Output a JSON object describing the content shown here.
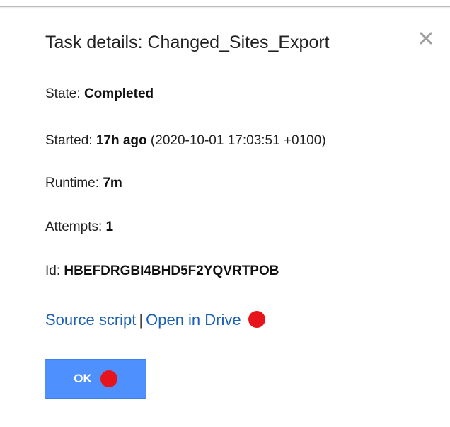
{
  "dialog": {
    "title": "Task details: Changed_Sites_Export",
    "close_icon": "close-icon"
  },
  "details": {
    "state_label": "State:",
    "state_value": "Completed",
    "started_label": "Started:",
    "started_value": "17h ago",
    "started_timestamp": "(2020-10-01 17:03:51 +0100)",
    "runtime_label": "Runtime:",
    "runtime_value": "7m",
    "attempts_label": "Attempts:",
    "attempts_value": "1",
    "id_label": "Id:",
    "id_value": "HBEFDRGBI4BHD5F2YQVRTPOB"
  },
  "links": {
    "source_script": "Source script",
    "separator": "|",
    "open_in_drive": "Open in Drive"
  },
  "buttons": {
    "ok_label": "OK"
  },
  "colors": {
    "link": "#1a5fb4",
    "ok_button": "#4d90fe",
    "marker": "#e8141b"
  }
}
